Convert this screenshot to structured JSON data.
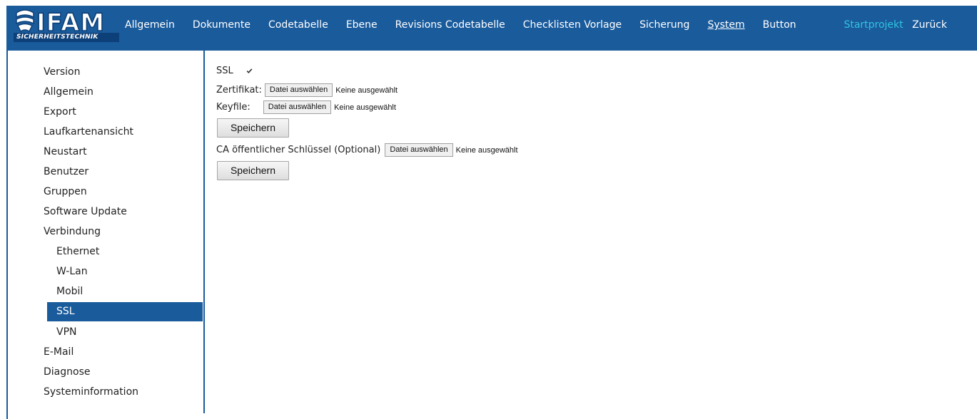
{
  "header": {
    "logo": {
      "brand": "IFAM",
      "subtitle": "SICHERHEITSTECHNIK"
    },
    "nav": [
      {
        "label": "Allgemein",
        "active": false
      },
      {
        "label": "Dokumente",
        "active": false
      },
      {
        "label": "Codetabelle",
        "active": false
      },
      {
        "label": "Ebene",
        "active": false
      },
      {
        "label": "Revisions Codetabelle",
        "active": false
      },
      {
        "label": "Checklisten Vorlage",
        "active": false
      },
      {
        "label": "Sicherung",
        "active": false
      },
      {
        "label": "System",
        "active": true
      },
      {
        "label": "Button",
        "active": false
      }
    ],
    "startprojekt": "Startprojekt",
    "back": "Zurück"
  },
  "sidebar": {
    "items": [
      {
        "label": "Version"
      },
      {
        "label": "Allgemein"
      },
      {
        "label": "Export"
      },
      {
        "label": "Laufkartenansicht"
      },
      {
        "label": "Neustart"
      },
      {
        "label": "Benutzer"
      },
      {
        "label": "Gruppen"
      },
      {
        "label": "Software Update"
      },
      {
        "label": "Verbindung"
      },
      {
        "label": "Ethernet",
        "sub": true
      },
      {
        "label": "W-Lan",
        "sub": true
      },
      {
        "label": "Mobil",
        "sub": true
      },
      {
        "label": "SSL",
        "sub": true,
        "active": true
      },
      {
        "label": "VPN",
        "sub": true
      },
      {
        "label": "E-Mail"
      },
      {
        "label": "Diagnose"
      },
      {
        "label": "Systeminformation"
      }
    ]
  },
  "main": {
    "ssl_label": "SSL",
    "ssl_checked": true,
    "cert_label": "Zertifikat:",
    "keyfile_label": "Keyfile:",
    "ca_label": "CA öffentlicher Schlüssel (Optional)",
    "file_button": "Datei auswählen",
    "no_file": "Keine ausgewählt",
    "save": "Speichern"
  },
  "colors": {
    "primary": "#1a5b9c",
    "accent": "#2fc4e0",
    "logo_dark": "#0d3f78"
  }
}
